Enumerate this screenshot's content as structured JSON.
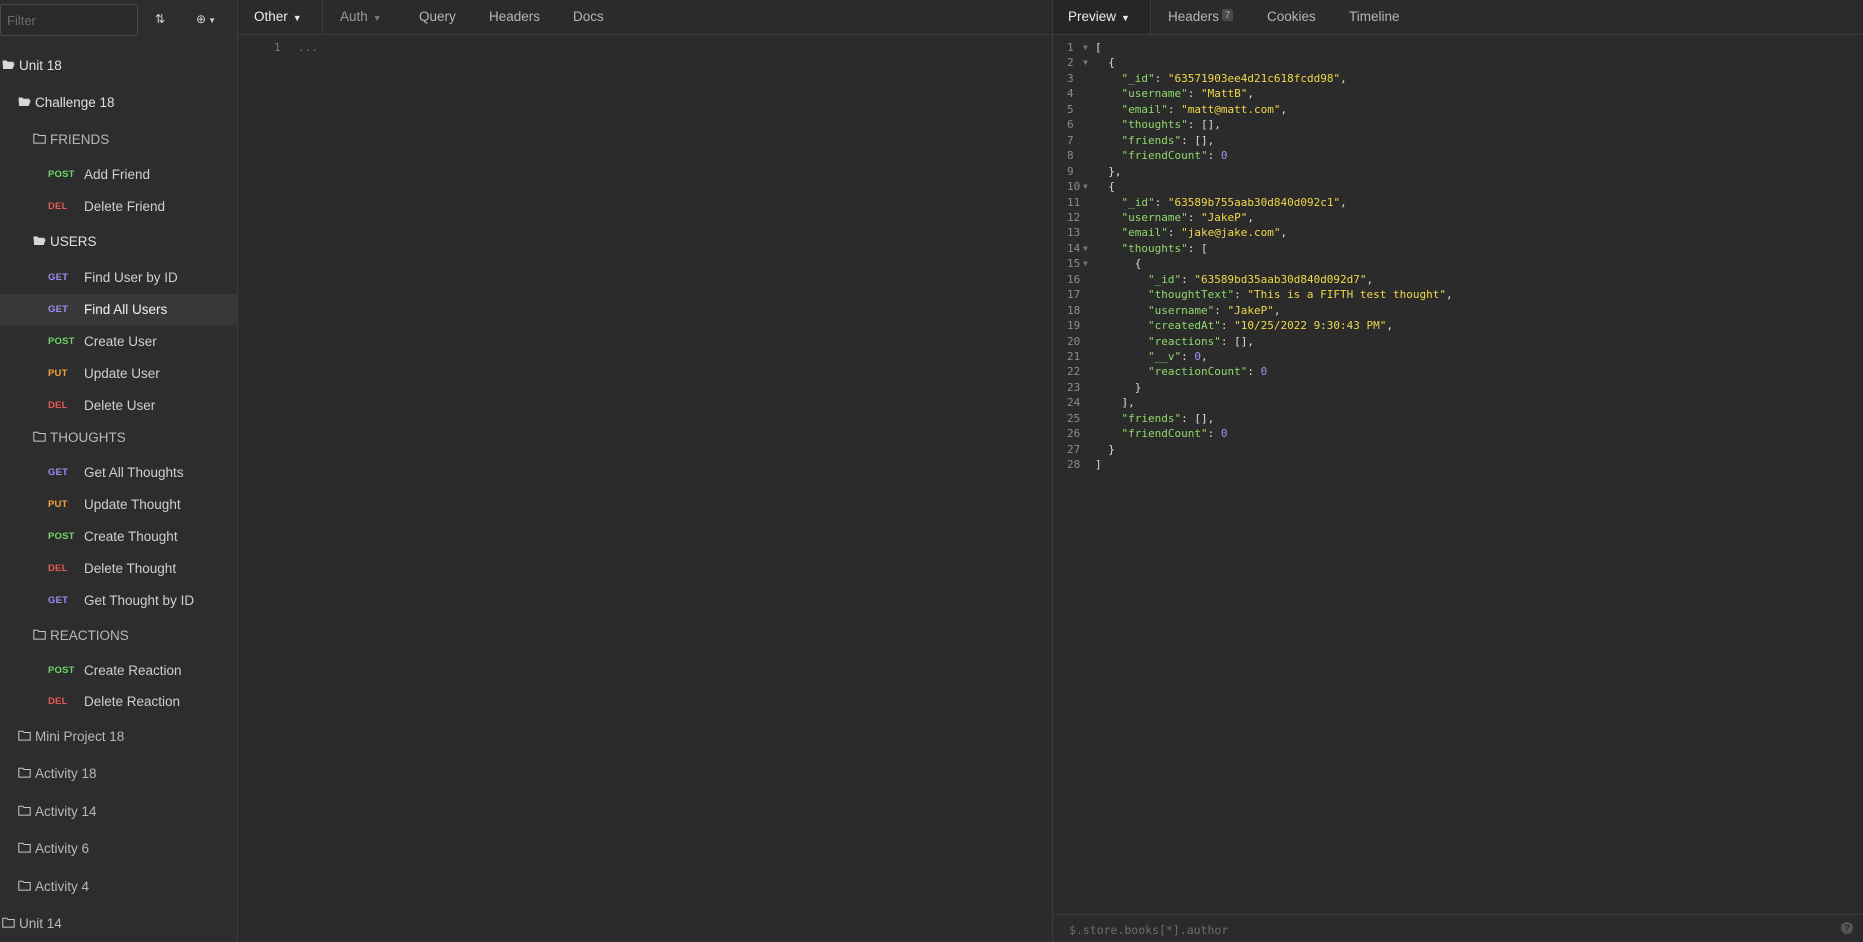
{
  "sidebar": {
    "filter_placeholder": "Filter",
    "tree": [
      {
        "kind": "folder",
        "label": "Unit 18",
        "open": true,
        "depth": 0
      },
      {
        "kind": "folder",
        "label": "Challenge 18",
        "open": true,
        "depth": 1
      },
      {
        "kind": "folder",
        "label": "FRIENDS",
        "open": false,
        "depth": 2,
        "dim": true
      },
      {
        "kind": "request",
        "method": "POST",
        "label": "Add Friend"
      },
      {
        "kind": "request",
        "method": "DEL",
        "label": "Delete Friend"
      },
      {
        "kind": "folder",
        "label": "USERS",
        "open": true,
        "depth": 2
      },
      {
        "kind": "request",
        "method": "GET",
        "label": "Find User by ID"
      },
      {
        "kind": "request",
        "method": "GET",
        "label": "Find All Users",
        "selected": true
      },
      {
        "kind": "request",
        "method": "POST",
        "label": "Create User"
      },
      {
        "kind": "request",
        "method": "PUT",
        "label": "Update User"
      },
      {
        "kind": "request",
        "method": "DEL",
        "label": "Delete User"
      },
      {
        "kind": "folder",
        "label": "THOUGHTS",
        "open": false,
        "depth": 2,
        "dim": true
      },
      {
        "kind": "request",
        "method": "GET",
        "label": "Get All Thoughts"
      },
      {
        "kind": "request",
        "method": "PUT",
        "label": "Update Thought"
      },
      {
        "kind": "request",
        "method": "POST",
        "label": "Create Thought"
      },
      {
        "kind": "request",
        "method": "DEL",
        "label": "Delete Thought"
      },
      {
        "kind": "request",
        "method": "GET",
        "label": "Get Thought by ID"
      },
      {
        "kind": "folder",
        "label": "REACTIONS",
        "open": false,
        "depth": 2,
        "dim": true
      },
      {
        "kind": "request",
        "method": "POST",
        "label": "Create Reaction"
      },
      {
        "kind": "request",
        "method": "DEL",
        "label": "Delete Reaction"
      },
      {
        "kind": "folder",
        "label": "Mini Project 18",
        "open": false,
        "depth": 1,
        "dim": true
      },
      {
        "kind": "folder",
        "label": "Activity 18",
        "open": false,
        "depth": 1,
        "dim": true
      },
      {
        "kind": "folder",
        "label": "Activity 14",
        "open": false,
        "depth": 1,
        "dim": true
      },
      {
        "kind": "folder",
        "label": "Activity 6",
        "open": false,
        "depth": 1,
        "dim": true
      },
      {
        "kind": "folder",
        "label": "Activity 4",
        "open": false,
        "depth": 1,
        "dim": true
      },
      {
        "kind": "folder",
        "label": "Unit 14",
        "open": false,
        "depth": 0,
        "dim": true
      }
    ]
  },
  "request": {
    "tabs": {
      "body": "Other",
      "auth": "Auth",
      "query": "Query",
      "headers": "Headers",
      "docs": "Docs"
    },
    "editor": {
      "line": "1",
      "placeholder": "..."
    }
  },
  "response": {
    "tabs": {
      "preview": "Preview",
      "headers": "Headers",
      "headers_count": "7",
      "cookies": "Cookies",
      "timeline": "Timeline"
    },
    "json_lines": [
      [
        [
          "p",
          "["
        ]
      ],
      [
        [
          "p",
          "  {"
        ]
      ],
      [
        [
          "p",
          "    "
        ],
        [
          "k",
          "\"_id\""
        ],
        [
          "p",
          ": "
        ],
        [
          "s",
          "\"63571903ee4d21c618fcdd98\""
        ],
        [
          "p",
          ","
        ]
      ],
      [
        [
          "p",
          "    "
        ],
        [
          "k",
          "\"username\""
        ],
        [
          "p",
          ": "
        ],
        [
          "s",
          "\"MattB\""
        ],
        [
          "p",
          ","
        ]
      ],
      [
        [
          "p",
          "    "
        ],
        [
          "k",
          "\"email\""
        ],
        [
          "p",
          ": "
        ],
        [
          "s",
          "\"matt@matt.com\""
        ],
        [
          "p",
          ","
        ]
      ],
      [
        [
          "p",
          "    "
        ],
        [
          "k",
          "\"thoughts\""
        ],
        [
          "p",
          ": [],"
        ]
      ],
      [
        [
          "p",
          "    "
        ],
        [
          "k",
          "\"friends\""
        ],
        [
          "p",
          ": [],"
        ]
      ],
      [
        [
          "p",
          "    "
        ],
        [
          "k",
          "\"friendCount\""
        ],
        [
          "p",
          ": "
        ],
        [
          "n",
          "0"
        ]
      ],
      [
        [
          "p",
          "  },"
        ]
      ],
      [
        [
          "p",
          "  {"
        ]
      ],
      [
        [
          "p",
          "    "
        ],
        [
          "k",
          "\"_id\""
        ],
        [
          "p",
          ": "
        ],
        [
          "s",
          "\"63589b755aab30d840d092c1\""
        ],
        [
          "p",
          ","
        ]
      ],
      [
        [
          "p",
          "    "
        ],
        [
          "k",
          "\"username\""
        ],
        [
          "p",
          ": "
        ],
        [
          "s",
          "\"JakeP\""
        ],
        [
          "p",
          ","
        ]
      ],
      [
        [
          "p",
          "    "
        ],
        [
          "k",
          "\"email\""
        ],
        [
          "p",
          ": "
        ],
        [
          "s",
          "\"jake@jake.com\""
        ],
        [
          "p",
          ","
        ]
      ],
      [
        [
          "p",
          "    "
        ],
        [
          "k",
          "\"thoughts\""
        ],
        [
          "p",
          ": ["
        ]
      ],
      [
        [
          "p",
          "      {"
        ]
      ],
      [
        [
          "p",
          "        "
        ],
        [
          "k",
          "\"_id\""
        ],
        [
          "p",
          ": "
        ],
        [
          "s",
          "\"63589bd35aab30d840d092d7\""
        ],
        [
          "p",
          ","
        ]
      ],
      [
        [
          "p",
          "        "
        ],
        [
          "k",
          "\"thoughtText\""
        ],
        [
          "p",
          ": "
        ],
        [
          "s",
          "\"This is a FIFTH test thought\""
        ],
        [
          "p",
          ","
        ]
      ],
      [
        [
          "p",
          "        "
        ],
        [
          "k",
          "\"username\""
        ],
        [
          "p",
          ": "
        ],
        [
          "s",
          "\"JakeP\""
        ],
        [
          "p",
          ","
        ]
      ],
      [
        [
          "p",
          "        "
        ],
        [
          "k",
          "\"createdAt\""
        ],
        [
          "p",
          ": "
        ],
        [
          "s",
          "\"10/25/2022 9:30:43 PM\""
        ],
        [
          "p",
          ","
        ]
      ],
      [
        [
          "p",
          "        "
        ],
        [
          "k",
          "\"reactions\""
        ],
        [
          "p",
          ": [],"
        ]
      ],
      [
        [
          "p",
          "        "
        ],
        [
          "k",
          "\"__v\""
        ],
        [
          "p",
          ": "
        ],
        [
          "n",
          "0"
        ],
        [
          "p",
          ","
        ]
      ],
      [
        [
          "p",
          "        "
        ],
        [
          "k",
          "\"reactionCount\""
        ],
        [
          "p",
          ": "
        ],
        [
          "n",
          "0"
        ]
      ],
      [
        [
          "p",
          "      }"
        ]
      ],
      [
        [
          "p",
          "    ],"
        ]
      ],
      [
        [
          "p",
          "    "
        ],
        [
          "k",
          "\"friends\""
        ],
        [
          "p",
          ": [],"
        ]
      ],
      [
        [
          "p",
          "    "
        ],
        [
          "k",
          "\"friendCount\""
        ],
        [
          "p",
          ": "
        ],
        [
          "n",
          "0"
        ]
      ],
      [
        [
          "p",
          "  }"
        ]
      ],
      [
        [
          "p",
          "]"
        ]
      ]
    ],
    "foldable_lines": [
      1,
      2,
      10,
      14,
      15
    ],
    "filter_placeholder": "$.store.books[*].author",
    "help_icon": "?"
  }
}
